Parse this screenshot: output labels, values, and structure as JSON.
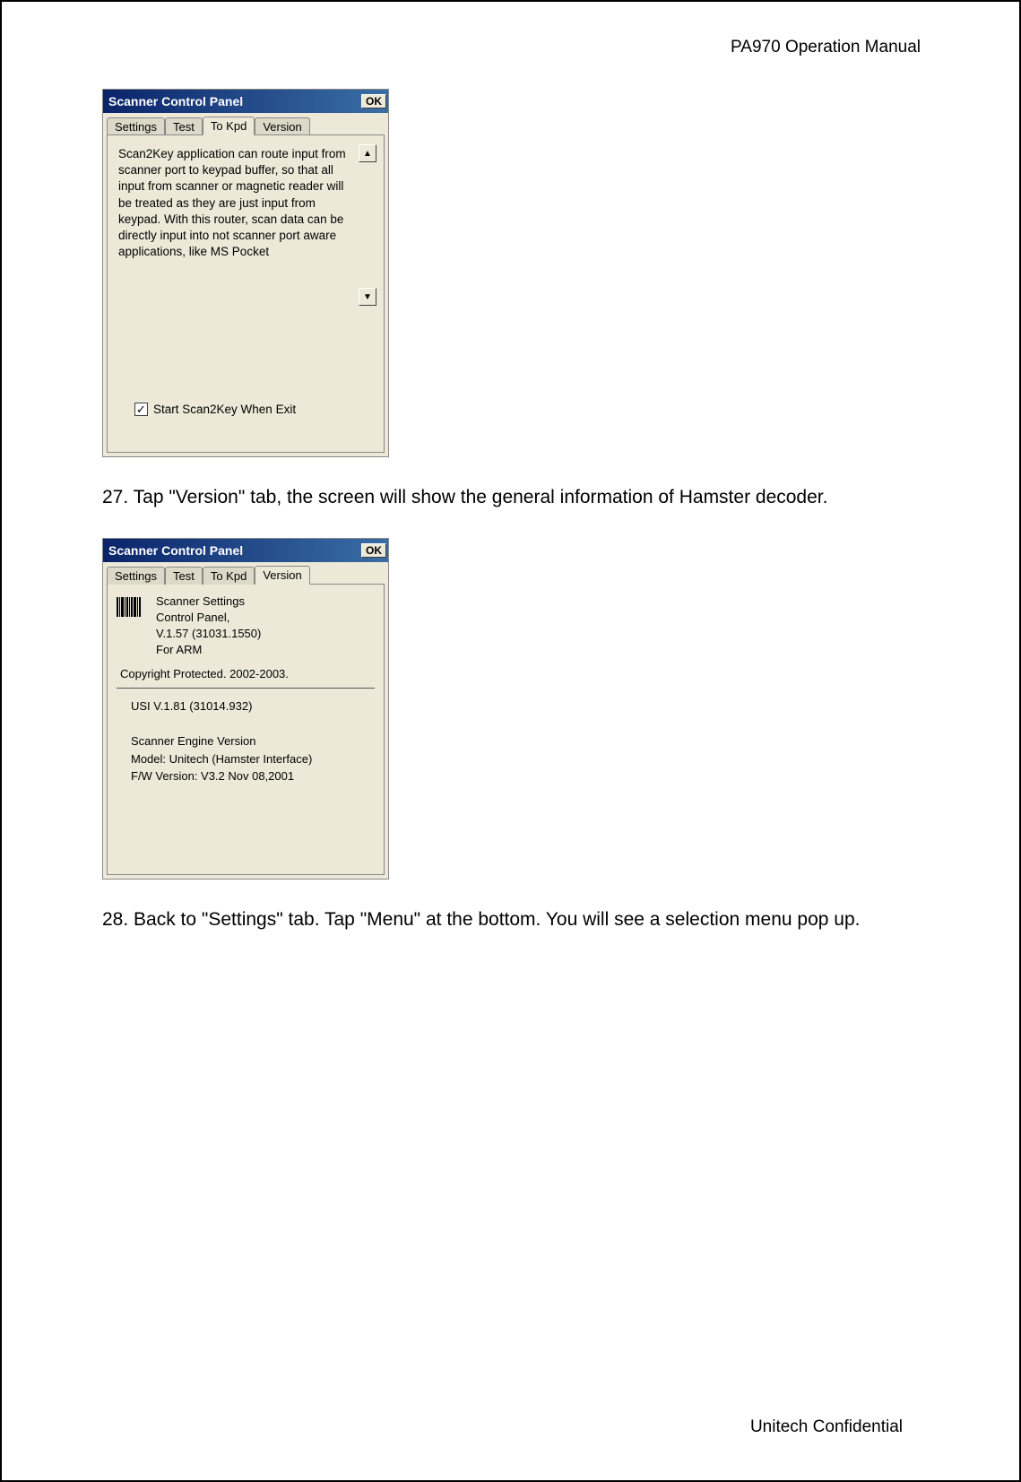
{
  "header": {
    "title": "PA970 Operation Manual"
  },
  "footer": {
    "text": "Unitech Confidential"
  },
  "panel1": {
    "title": "Scanner Control Panel",
    "ok": "OK",
    "tabs": {
      "settings": "Settings",
      "test": "Test",
      "tokpd": "To Kpd",
      "version": "Version"
    },
    "scroll_text": "Scan2Key application can route input from scanner port to keypad buffer, so that all input from scanner or magnetic reader will be treated as they are just input from keypad. With this router, scan data can be directly input into not scanner port aware applications, like MS Pocket",
    "scroll_up": "▲",
    "scroll_down": "▼",
    "checkbox_mark": "✓",
    "checkbox_label": "Start Scan2Key When Exit"
  },
  "step27": "27. Tap \"Version\" tab, the screen will show the general information of Hamster decoder.",
  "panel2": {
    "title": "Scanner Control Panel",
    "ok": "OK",
    "tabs": {
      "settings": "Settings",
      "test": "Test",
      "tokpd": "To Kpd",
      "version": "Version"
    },
    "info_line1": "Scanner Settings",
    "info_line2": "Control Panel,",
    "info_line3": "V.1.57 (31031.1550)",
    "info_line4": "For ARM",
    "copyright": "Copyright Protected. 2002-2003.",
    "usi": "USI V.1.81 (31014.932)",
    "engine_title": "Scanner Engine Version",
    "engine_model": "Model: Unitech (Hamster Interface)",
    "engine_fw": "F/W Version: V3.2 Nov 08,2001"
  },
  "step28": "28. Back to \"Settings\" tab. Tap \"Menu\" at the bottom. You will see a selection menu pop up."
}
